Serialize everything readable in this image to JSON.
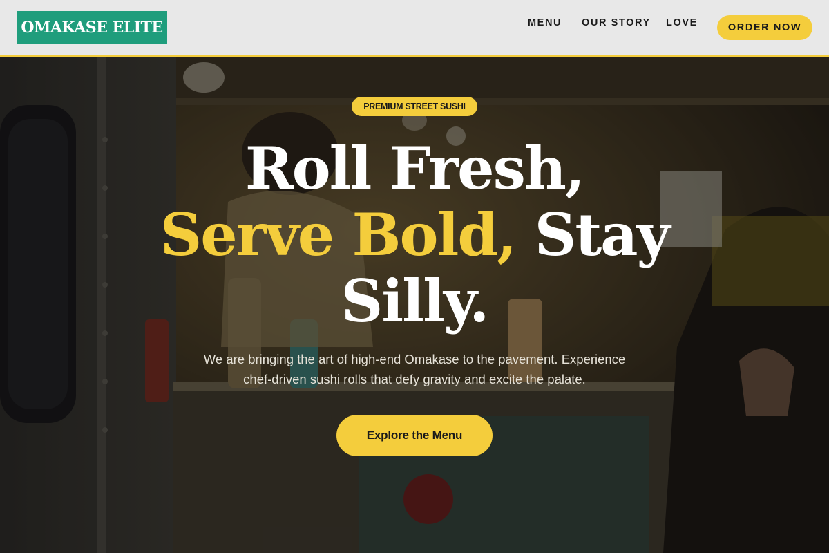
{
  "header": {
    "logo": "OMAKASE ELITE",
    "nav": [
      "MENU",
      "OUR STORY",
      "LOVE"
    ],
    "cta": "ORDER NOW"
  },
  "hero": {
    "badge": "PREMIUM STREET SUSHI",
    "headline": {
      "line1": "Roll Fresh,",
      "line2_accent": "Serve Bold,",
      "line2_rest": " Stay",
      "line3": "Silly."
    },
    "subtext_line1": "We are bringing the art of high-end Omakase to the pavement. Experience",
    "subtext_line2": "chef-driven sushi rolls that defy gravity and excite the palate.",
    "cta": "Explore the Menu"
  },
  "colors": {
    "brand_green": "#1f9d7c",
    "accent_yellow": "#f4cd3c",
    "header_bg": "#e8e8e8",
    "text_dark": "#1a1a1a"
  }
}
